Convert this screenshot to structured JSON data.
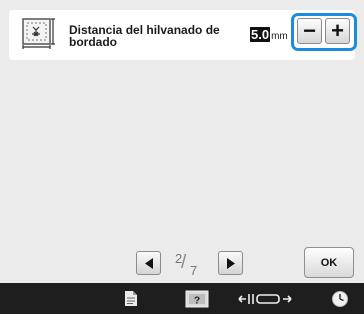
{
  "setting": {
    "icon": "basting-frame-icon",
    "label_line1": "Distancia del hilvanado de",
    "label_line2": "bordado",
    "value": "5.0",
    "unit": "mm",
    "decrease_label": "−",
    "increase_label": "+"
  },
  "pager": {
    "current_page": "2",
    "total_pages": "7",
    "ok_label": "OK"
  },
  "bottom_bar": {
    "items": [
      "document-icon",
      "frame-help-icon",
      "frame-move-icon",
      "clock-icon"
    ]
  },
  "colors": {
    "accent": "#1c8ce0",
    "background": "#ebebeb",
    "bar": "#1e1e1e"
  }
}
